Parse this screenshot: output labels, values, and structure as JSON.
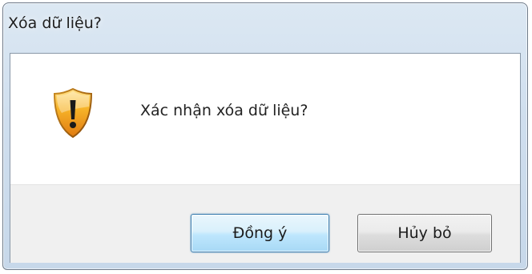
{
  "window": {
    "title": "Xóa dữ liệu?"
  },
  "dialog": {
    "icon": "warning-shield-icon",
    "message": "Xác nhận xóa dữ liệu?"
  },
  "buttons": {
    "ok_label": "Đồng ý",
    "cancel_label": "Hủy bỏ"
  },
  "colors": {
    "shield_orange": "#f0a020",
    "default_button_border": "#3c7fb1",
    "footer_bg": "#f0f0f0"
  }
}
